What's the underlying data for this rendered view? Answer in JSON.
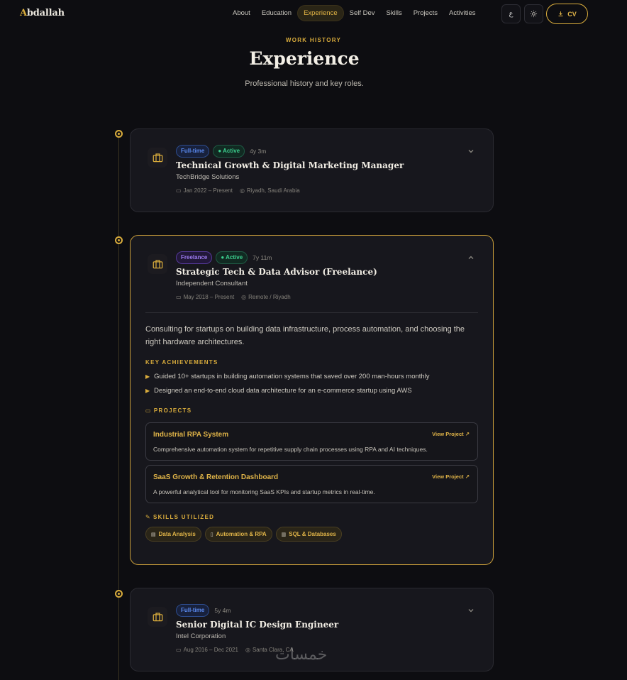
{
  "nav": {
    "logo_first": "A",
    "logo_rest": "bdallah",
    "links": [
      "About",
      "Education",
      "Experience",
      "Self Dev",
      "Skills",
      "Projects",
      "Activities"
    ],
    "active_link": "Experience",
    "lang_label": "ع",
    "cv_label": "CV"
  },
  "header": {
    "eyebrow": "WORK HISTORY",
    "title": "Experience",
    "subtitle": "Professional history and key roles."
  },
  "experiences": [
    {
      "type": "Full-time",
      "status": "Active",
      "duration": "4y 3m",
      "role": "Technical Growth & Digital Marketing Manager",
      "company": "TechBridge Solutions",
      "dates": "Jan 2022 – Present",
      "location": "Riyadh, Saudi Arabia",
      "expanded": false
    },
    {
      "type": "Freelance",
      "status": "Active",
      "duration": "7y 11m",
      "role": "Strategic Tech & Data Advisor (Freelance)",
      "company": "Independent Consultant",
      "dates": "May 2018 – Present",
      "location": "Remote / Riyadh",
      "expanded": true,
      "description": "Consulting for startups on building data infrastructure, process automation, and choosing the right hardware architectures.",
      "achievements_label": "KEY ACHIEVEMENTS",
      "achievements": [
        "Guided 10+ startups in building automation systems that saved over 200 man-hours monthly",
        "Designed an end-to-end cloud data architecture for an e-commerce startup using AWS"
      ],
      "projects_label": "PROJECTS",
      "projects": [
        {
          "title": "Industrial RPA System",
          "link": "View Project ↗",
          "desc": "Comprehensive automation system for repetitive supply chain processes using RPA and AI techniques."
        },
        {
          "title": "SaaS Growth & Retention Dashboard",
          "link": "View Project ↗",
          "desc": "A powerful analytical tool for monitoring SaaS KPIs and startup metrics in real-time."
        }
      ],
      "skills_label": "SKILLS UTILIZED",
      "skills": [
        "Data Analysis",
        "Automation & RPA",
        "SQL & Databases"
      ]
    },
    {
      "type": "Full-time",
      "duration": "5y 4m",
      "role": "Senior Digital IC Design Engineer",
      "company": "Intel Corporation",
      "dates": "Aug 2016 – Dec 2021",
      "location": "Santa Clara, CA",
      "expanded": false
    }
  ],
  "watermark": "خمسات",
  "colors": {
    "background": "#0d0d11",
    "accent": "#d9ac3c",
    "card": "#17171d",
    "fulltime_badge": "#5b8bf0",
    "freelance_badge": "#9d7bf0",
    "active_badge": "#3ccf8e"
  }
}
